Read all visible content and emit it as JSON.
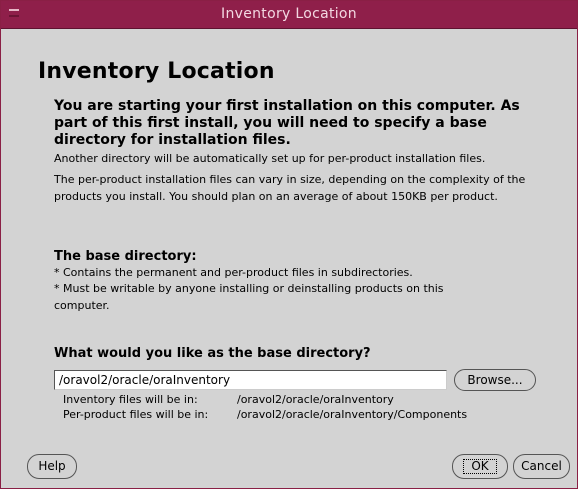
{
  "window": {
    "title": "Inventory Location",
    "titlebar_color": "#8f1f4a",
    "background_color": "#d3d3d3"
  },
  "content": {
    "heading": "Inventory Location",
    "intro_bold": "You are starting your first installation on this computer. As part of this first install, you will need to specify a base directory for installation files.",
    "intro_line": "Another directory will be automatically set up for per-product installation files.",
    "size_note": "The per-product installation files can vary in size, depending on the complexity of the products you install.  You should plan on an average of about 150KB per product.",
    "base_dir_heading": "The base directory:",
    "base_dir_points": [
      "* Contains the permanent and per-product files in subdirectories.",
      "* Must be writable by anyone installing or deinstalling products on this computer."
    ],
    "question": "What would you like as the base directory?"
  },
  "form": {
    "base_directory_value": "/oravol2/oracle/oraInventory",
    "browse_label": "Browse...",
    "inventory_label": "Inventory files will be in:",
    "inventory_path": "/oravol2/oracle/oraInventory",
    "per_product_label": "Per-product files will be in:",
    "per_product_path": "/oravol2/oracle/oraInventory/Components"
  },
  "buttons": {
    "help": "Help",
    "ok": "OK",
    "cancel": "Cancel"
  }
}
